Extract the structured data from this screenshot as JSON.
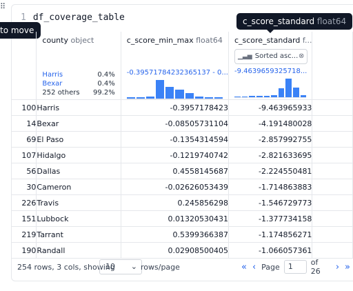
{
  "cell": {
    "line_number": "1",
    "code": "df_coverage_table"
  },
  "drag_tooltip": "to move",
  "column_tooltip": {
    "name": "c_score_standard",
    "dtype": "float64"
  },
  "columns": [
    {
      "name": "county",
      "dtype": "object"
    },
    {
      "name": "c_score_min_max",
      "dtype": "float64"
    },
    {
      "name": "c_score_standard",
      "dtype": "f..."
    }
  ],
  "county_stats": [
    {
      "label": "Harris",
      "pct": "0.4%"
    },
    {
      "label": "Bexar",
      "pct": "0.4%"
    },
    {
      "label": "252 others",
      "pct": "99.2%"
    }
  ],
  "minmax_summary": "-0.39571784232365137 - 0...",
  "standard_summary": "-9.4639659325718...",
  "sorted_label": "Sorted asc...",
  "histograms": {
    "minmax": [
      0.06,
      0.08,
      0.1,
      0.95,
      0.6,
      0.45,
      0.3,
      0.12,
      0.08,
      0.06
    ],
    "standard": [
      0.05,
      0.05,
      0.06,
      0.06,
      0.08,
      0.1,
      0.45,
      0.95,
      0.5,
      0.12
    ]
  },
  "rows": [
    {
      "idx": "100",
      "county": "Harris",
      "minmax": "-0.3957178423",
      "standard": "-9.463965933"
    },
    {
      "idx": "14",
      "county": "Bexar",
      "minmax": "-0.08505731104",
      "standard": "-4.191480028"
    },
    {
      "idx": "69",
      "county": "El Paso",
      "minmax": "-0.1354314594",
      "standard": "-2.857992755"
    },
    {
      "idx": "107",
      "county": "Hidalgo",
      "minmax": "-0.1219740742",
      "standard": "-2.821633695"
    },
    {
      "idx": "56",
      "county": "Dallas",
      "minmax": "0.4558145687",
      "standard": "-2.224550481"
    },
    {
      "idx": "30",
      "county": "Cameron",
      "minmax": "-0.02626053439",
      "standard": "-1.714863883"
    },
    {
      "idx": "226",
      "county": "Travis",
      "minmax": "0.245856298",
      "standard": "-1.546729773"
    },
    {
      "idx": "151",
      "county": "Lubbock",
      "minmax": "0.01320530431",
      "standard": "-1.377734158"
    },
    {
      "idx": "219",
      "county": "Tarrant",
      "minmax": "0.5399366387",
      "standard": "-1.174856271"
    },
    {
      "idx": "190",
      "county": "Randall",
      "minmax": "0.02908500405",
      "standard": "-1.066057361"
    }
  ],
  "footer": {
    "info": "254 rows, 3 cols, showing",
    "page_size": "10",
    "rows_per_page": "rows/page",
    "page_label": "Page",
    "page_value": "1",
    "of_pages": "of 26"
  },
  "colors": {
    "accent": "#2563eb",
    "bar": "#3b82f6",
    "tooltip_bg": "#111827"
  }
}
